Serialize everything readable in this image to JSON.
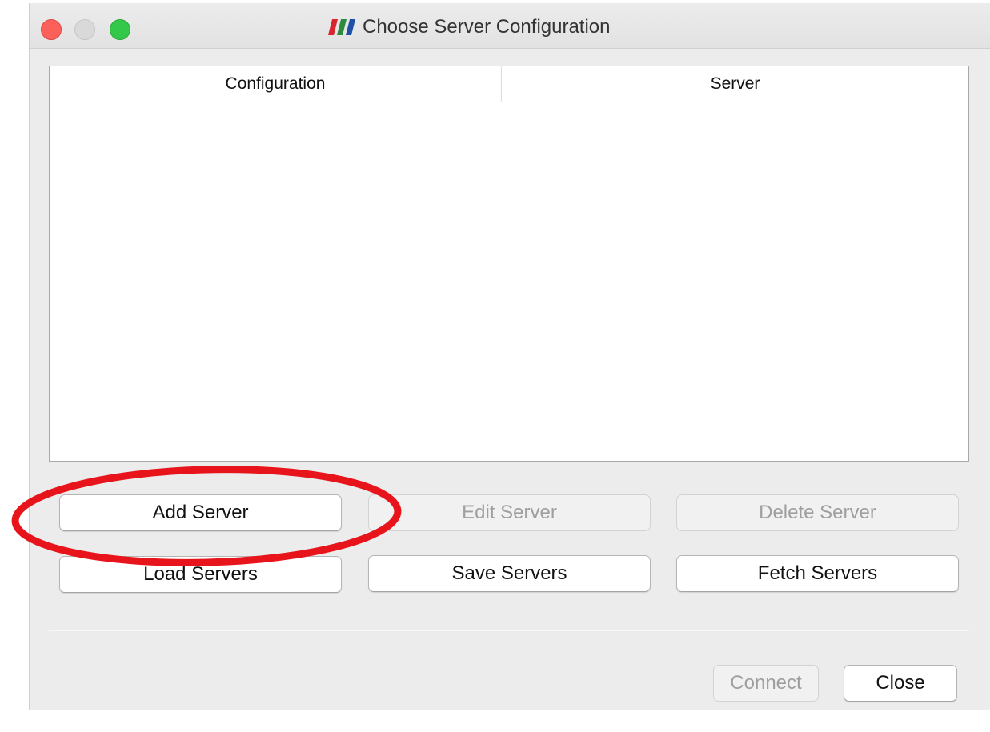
{
  "window": {
    "title": "Choose Server Configuration",
    "app_icon": "paraview-logo-icon"
  },
  "titlebar": {
    "controls": [
      "close-window-icon",
      "minimize-window-icon",
      "zoom-window-icon"
    ]
  },
  "table": {
    "columns": [
      "Configuration",
      "Server"
    ],
    "rows": []
  },
  "buttons": {
    "add": "Add Server",
    "edit": "Edit Server",
    "delete": "Delete Server",
    "load": "Load Servers",
    "save": "Save Servers",
    "fetch": "Fetch Servers",
    "connect": "Connect",
    "close": "Close"
  },
  "button_states": {
    "edit": "disabled",
    "delete": "disabled",
    "connect": "disabled"
  },
  "annotation": {
    "shape": "ellipse",
    "color": "#e8141b",
    "target": "Add Server"
  },
  "colors": {
    "close": "#fc605b",
    "minimize": "#d9d9d9",
    "zoom": "#34c84a",
    "logo": [
      "#d7262e",
      "#2d8a3e",
      "#1f4fa8"
    ]
  }
}
